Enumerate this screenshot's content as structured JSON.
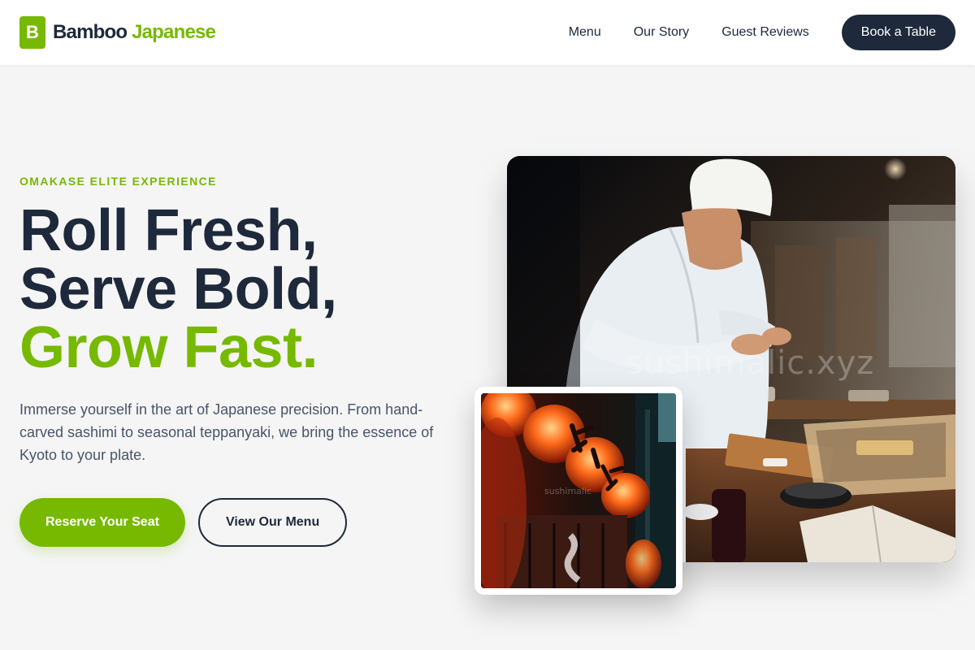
{
  "brand": {
    "badge": "B",
    "name": "Bamboo",
    "name_accent": "Japanese",
    "accent_color": "#76b900",
    "dark_color": "#1e293b"
  },
  "nav": {
    "items": [
      "Menu",
      "Our Story",
      "Guest Reviews"
    ],
    "cta": "Book a Table"
  },
  "hero": {
    "eyebrow": "OMAKASE ELITE EXPERIENCE",
    "headline": [
      "Roll Fresh,",
      "Serve Bold,",
      "Grow Fast."
    ],
    "description": "Immerse yourself in the art of Japanese precision. From hand-carved sashimi to seasonal teppanyaki, we bring the essence of Kyoto to your plate.",
    "primary_cta": "Reserve Your Seat",
    "secondary_cta": "View Our Menu"
  },
  "images": {
    "main": {
      "subject": "sushi chef preparing nigiri at wooden counter",
      "watermark": "sushimalic.xyz"
    },
    "inset": {
      "subject": "glowing red paper lanterns at night",
      "watermark": "sushimalic"
    }
  }
}
